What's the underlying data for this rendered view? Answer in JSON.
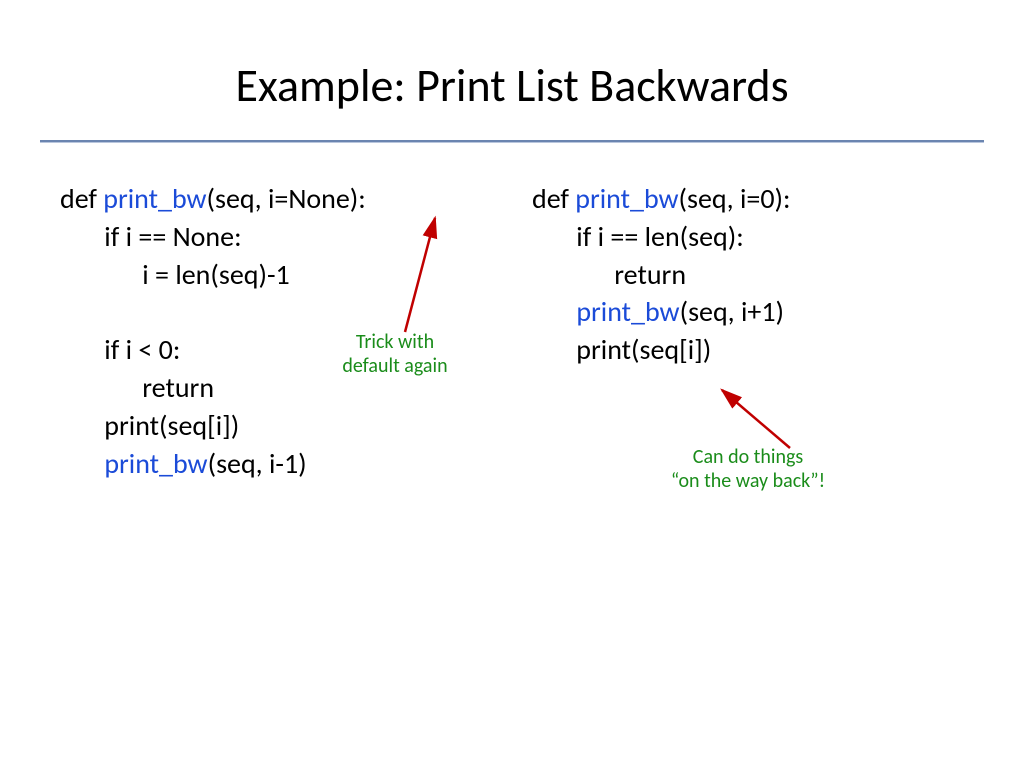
{
  "title": "Example: Print List Backwards",
  "left": {
    "l1_def": "def ",
    "l1_fn": "print_bw",
    "l1_rest": "(seq, i=None):",
    "l2": "       if i == None:",
    "l3": "             i = len(seq)-1",
    "l4": "",
    "l5": "       if i < 0:",
    "l6": "             return",
    "l7": "       print(seq[i])",
    "l8a": "       ",
    "l8_fn": "print_bw",
    "l8b": "(seq, i-1)"
  },
  "right": {
    "l1_def": "def ",
    "l1_fn": "print_bw",
    "l1_rest": "(seq, i=0):",
    "l2": "       if i == len(seq):",
    "l3": "             return",
    "l4a": "       ",
    "l4_fn": "print_bw",
    "l4b": "(seq, i+1)",
    "l5": "       print(seq[i])"
  },
  "annot1_line1": "Trick with",
  "annot1_line2": "default again",
  "annot2_line1": "Can do things",
  "annot2_line2": "“on the way back”!",
  "colors": {
    "keyword_blue": "#1b4bd8",
    "annotation_green": "#1a8c1a",
    "arrow_red": "#c00000",
    "rule_blue": "#6b85b0"
  }
}
